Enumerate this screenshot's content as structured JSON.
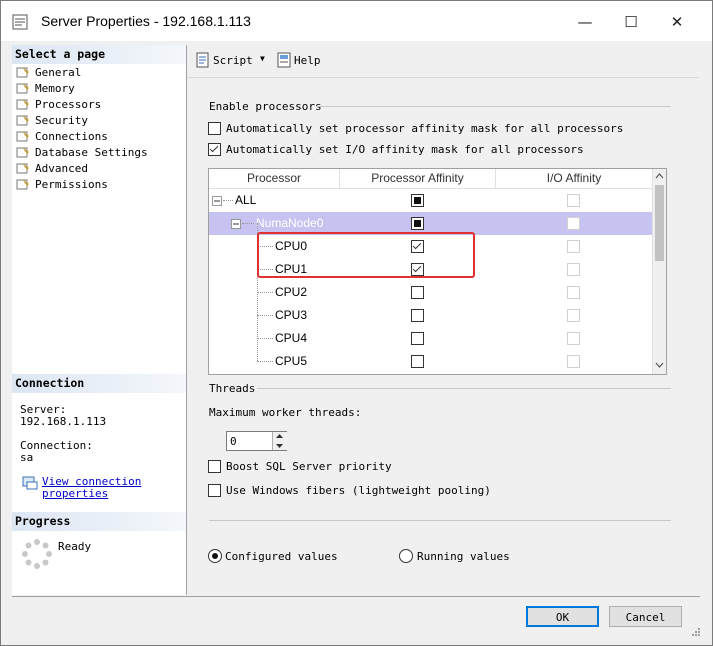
{
  "window": {
    "title": "Server Properties - 192.168.1.113",
    "minimize": "—",
    "maximize": "☐",
    "close": "✕"
  },
  "left": {
    "select_page_header": "Select a page",
    "pages": [
      "General",
      "Memory",
      "Processors",
      "Security",
      "Connections",
      "Database Settings",
      "Advanced",
      "Permissions"
    ],
    "connection_header": "Connection",
    "server_label": "Server:",
    "server_value": "192.168.1.113",
    "connection_label": "Connection:",
    "connection_value": "sa",
    "view_link_line1": "View connection",
    "view_link_line2": "properties",
    "progress_header": "Progress",
    "progress_status": "Ready"
  },
  "toolbar": {
    "script_label": "Script",
    "dropdown_glyph": "▼",
    "help_label": "Help"
  },
  "processors": {
    "enable_group": "Enable processors",
    "auto_processor_mask": {
      "label": "Automatically set processor affinity mask for all processors",
      "checked": false
    },
    "auto_io_mask": {
      "label": "Automatically set I/O affinity mask for all processors",
      "checked": true
    },
    "grid": {
      "columns": [
        "Processor",
        "Processor Affinity",
        "I/O Affinity"
      ],
      "rows": [
        {
          "label": "ALL",
          "affinity": "filled",
          "io": "disabled"
        },
        {
          "label": "NumaNode0",
          "affinity": "filled",
          "io": "disabled"
        },
        {
          "label": "CPU0",
          "affinity": "checked",
          "io": "disabled"
        },
        {
          "label": "CPU1",
          "affinity": "checked",
          "io": "disabled"
        },
        {
          "label": "CPU2",
          "affinity": "unchecked",
          "io": "disabled"
        },
        {
          "label": "CPU3",
          "affinity": "unchecked",
          "io": "disabled"
        },
        {
          "label": "CPU4",
          "affinity": "unchecked",
          "io": "disabled"
        },
        {
          "label": "CPU5",
          "affinity": "unchecked",
          "io": "disabled"
        }
      ]
    },
    "threads_group": "Threads",
    "max_worker_label": "Maximum worker threads:",
    "max_worker_value": "0",
    "boost_priority": {
      "label": "Boost SQL Server priority",
      "checked": false
    },
    "windows_fibers": {
      "label": "Use Windows fibers (lightweight pooling)",
      "checked": false
    },
    "configured_values": "Configured  values",
    "running_values": "Running values"
  },
  "buttons": {
    "ok": "OK",
    "cancel": "Cancel"
  },
  "colors": {
    "selection": "#c7c3f0",
    "highlight_box": "#e03030",
    "link": "#0000cc"
  }
}
